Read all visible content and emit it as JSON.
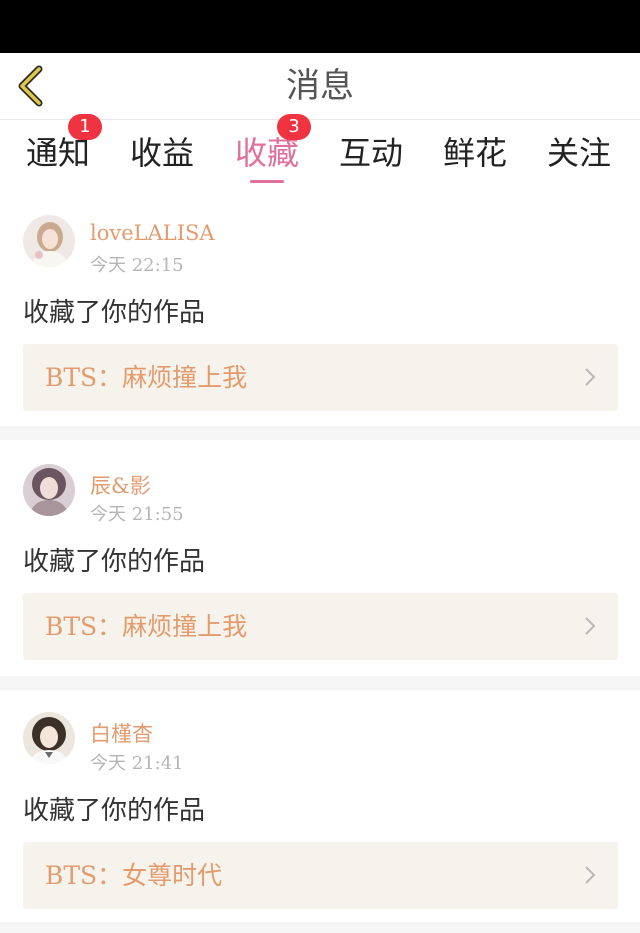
{
  "header": {
    "title": "消息"
  },
  "tabs": [
    {
      "label": "通知",
      "badge": "1"
    },
    {
      "label": "收益",
      "badge": null
    },
    {
      "label": "收藏",
      "badge": "3",
      "active": true
    },
    {
      "label": "互动",
      "badge": null
    },
    {
      "label": "鲜花",
      "badge": null
    },
    {
      "label": "关注",
      "badge": null
    }
  ],
  "messages": [
    {
      "username": "loveLALISA",
      "time": "今天 22:15",
      "action": "收藏了你的作品",
      "work": "BTS：麻烦撞上我",
      "avatar_icon": "user-avatar-1"
    },
    {
      "username": "辰&影",
      "time": "今天 21:55",
      "action": "收藏了你的作品",
      "work": "BTS：麻烦撞上我",
      "avatar_icon": "user-avatar-2"
    },
    {
      "username": "白槿杳",
      "time": "今天 21:41",
      "action": "收藏了你的作品",
      "work": "BTS：女尊时代",
      "avatar_icon": "user-avatar-3"
    }
  ],
  "colors": {
    "accent": "#e0709c",
    "username": "#e39b6e",
    "badge": "#ef3340",
    "link_bg": "#f5f3ec",
    "back_icon": "#c9a227"
  }
}
